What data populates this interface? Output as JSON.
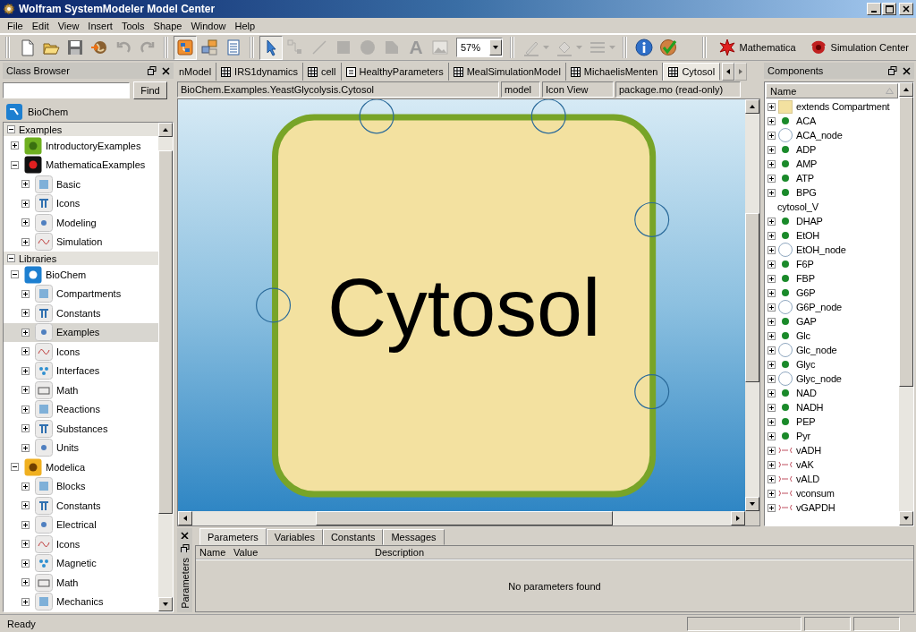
{
  "window": {
    "title": "Wolfram SystemModeler Model Center"
  },
  "menu": [
    "File",
    "Edit",
    "View",
    "Insert",
    "Tools",
    "Shape",
    "Window",
    "Help"
  ],
  "toolbar": {
    "groups": [
      [
        {
          "kind": "new",
          "disabled": false,
          "pressed": false
        },
        {
          "kind": "open",
          "disabled": false,
          "pressed": false
        },
        {
          "kind": "save",
          "disabled": false,
          "pressed": false
        },
        {
          "kind": "publish",
          "disabled": false,
          "pressed": false
        },
        {
          "kind": "undo",
          "disabled": true,
          "pressed": false
        },
        {
          "kind": "redo",
          "disabled": true,
          "pressed": false
        }
      ],
      [
        {
          "kind": "diagram",
          "disabled": false,
          "pressed": true
        },
        {
          "kind": "iconview",
          "disabled": false,
          "pressed": false
        },
        {
          "kind": "textview",
          "disabled": false,
          "pressed": false
        }
      ],
      [
        {
          "kind": "select",
          "disabled": false,
          "pressed": true
        },
        {
          "kind": "connect",
          "disabled": true,
          "pressed": false
        },
        {
          "kind": "line",
          "disabled": true,
          "pressed": false
        },
        {
          "kind": "rect",
          "disabled": true,
          "pressed": false
        },
        {
          "kind": "ellipse",
          "disabled": true,
          "pressed": false
        },
        {
          "kind": "polygon",
          "disabled": true,
          "pressed": false
        },
        {
          "kind": "text",
          "label": "A",
          "disabled": true,
          "pressed": false
        },
        {
          "kind": "bitmap",
          "disabled": true,
          "pressed": false
        },
        {
          "kind": "zoom",
          "value": "57%"
        }
      ],
      [
        {
          "kind": "linecolor",
          "disabled": true,
          "pressed": false
        },
        {
          "kind": "fillcolor",
          "disabled": true,
          "pressed": false
        },
        {
          "kind": "linestyle",
          "disabled": true,
          "pressed": false
        }
      ],
      [
        {
          "kind": "info",
          "disabled": false,
          "pressed": false
        },
        {
          "kind": "check",
          "disabled": false,
          "pressed": false
        }
      ],
      [
        {
          "kind": "mathematica",
          "label": "Mathematica",
          "disabled": false,
          "pressed": false
        },
        {
          "kind": "simulation",
          "label": "Simulation Center",
          "disabled": false,
          "pressed": false
        }
      ]
    ]
  },
  "class_browser": {
    "title": "Class Browser",
    "search_button": "Find",
    "library": "BioChem",
    "sections": [
      {
        "label": "Examples",
        "expanded": true,
        "items": [
          {
            "label": "IntroductoryExamples",
            "expanded": false,
            "selected": false
          },
          {
            "label": "MathematicaExamples",
            "expanded": true,
            "selected": false,
            "children": [
              {
                "label": "Basic",
                "expanded": false,
                "selected": false
              },
              {
                "label": "Icons",
                "expanded": false,
                "selected": false
              },
              {
                "label": "Modeling",
                "expanded": false,
                "selected": false
              },
              {
                "label": "Simulation",
                "expanded": false,
                "selected": false
              }
            ]
          }
        ]
      },
      {
        "label": "Libraries",
        "expanded": true,
        "items": [
          {
            "label": "BioChem",
            "expanded": true,
            "selected": false,
            "children": [
              {
                "label": "Compartments",
                "expanded": false,
                "selected": false
              },
              {
                "label": "Constants",
                "expanded": false,
                "selected": false
              },
              {
                "label": "Examples",
                "expanded": false,
                "selected": true
              },
              {
                "label": "Icons",
                "expanded": false,
                "selected": false
              },
              {
                "label": "Interfaces",
                "expanded": false,
                "selected": false
              },
              {
                "label": "Math",
                "expanded": false,
                "selected": false
              },
              {
                "label": "Reactions",
                "expanded": false,
                "selected": false
              },
              {
                "label": "Substances",
                "expanded": false,
                "selected": false
              },
              {
                "label": "Units",
                "expanded": false,
                "selected": false
              }
            ]
          },
          {
            "label": "Modelica",
            "expanded": true,
            "selected": false,
            "children": [
              {
                "label": "Blocks",
                "expanded": false,
                "selected": false
              },
              {
                "label": "Constants",
                "expanded": false,
                "selected": false
              },
              {
                "label": "Electrical",
                "expanded": false,
                "selected": false
              },
              {
                "label": "Icons",
                "expanded": false,
                "selected": false
              },
              {
                "label": "Magnetic",
                "expanded": false,
                "selected": false
              },
              {
                "label": "Math",
                "expanded": false,
                "selected": false
              },
              {
                "label": "Mechanics",
                "expanded": false,
                "selected": false
              }
            ]
          }
        ]
      }
    ]
  },
  "editor": {
    "tabs": [
      {
        "label": "nModel",
        "selected": false
      },
      {
        "label": "IRS1dynamics",
        "kind": "model",
        "selected": false
      },
      {
        "label": "cell",
        "kind": "model",
        "selected": false
      },
      {
        "label": "HealthyParameters",
        "kind": "record",
        "selected": false
      },
      {
        "label": "MealSimulationModel",
        "kind": "model",
        "selected": false
      },
      {
        "label": "MichaelisMenten",
        "kind": "model",
        "selected": false
      },
      {
        "label": "Cytosol",
        "kind": "model",
        "selected": true
      }
    ],
    "path": "BioChem.Examples.YeastGlycolysis.Cytosol",
    "restriction": "model",
    "view": "Icon View",
    "file": "package.mo (read-only)",
    "diagram": {
      "label": "Cytosol"
    }
  },
  "components": {
    "title": "Components",
    "column": "Name",
    "items": [
      {
        "kind": "folder",
        "label": "extends Compartment"
      },
      {
        "kind": "substance",
        "label": "ACA"
      },
      {
        "kind": "node",
        "label": "ACA_node"
      },
      {
        "kind": "substance",
        "label": "ADP"
      },
      {
        "kind": "substance",
        "label": "AMP"
      },
      {
        "kind": "substance",
        "label": "ATP"
      },
      {
        "kind": "substance",
        "label": "BPG"
      },
      {
        "kind": "parameter",
        "label": "cytosol_V"
      },
      {
        "kind": "substance",
        "label": "DHAP"
      },
      {
        "kind": "substance",
        "label": "EtOH"
      },
      {
        "kind": "node",
        "label": "EtOH_node"
      },
      {
        "kind": "substance",
        "label": "F6P"
      },
      {
        "kind": "substance",
        "label": "FBP"
      },
      {
        "kind": "substance",
        "label": "G6P"
      },
      {
        "kind": "node",
        "label": "G6P_node"
      },
      {
        "kind": "substance",
        "label": "GAP"
      },
      {
        "kind": "substance",
        "label": "Glc"
      },
      {
        "kind": "node",
        "label": "Glc_node"
      },
      {
        "kind": "substance",
        "label": "Glyc"
      },
      {
        "kind": "node",
        "label": "Glyc_node"
      },
      {
        "kind": "substance",
        "label": "NAD"
      },
      {
        "kind": "substance",
        "label": "NADH"
      },
      {
        "kind": "substance",
        "label": "PEP"
      },
      {
        "kind": "substance",
        "label": "Pyr"
      },
      {
        "kind": "reaction",
        "label": "vADH"
      },
      {
        "kind": "reaction",
        "label": "vAK"
      },
      {
        "kind": "reaction",
        "label": "vALD"
      },
      {
        "kind": "reaction",
        "label": "vconsum"
      },
      {
        "kind": "reaction",
        "label": "vGAPDH"
      }
    ]
  },
  "parameters_panel": {
    "side_label": "Parameters",
    "tabs": [
      {
        "label": "Parameters",
        "selected": true
      },
      {
        "label": "Variables",
        "selected": false
      },
      {
        "label": "Constants",
        "selected": false
      },
      {
        "label": "Messages",
        "selected": false
      }
    ],
    "columns": [
      "Name",
      "Value",
      "Description"
    ],
    "empty_message": "No parameters found"
  },
  "status_bar": {
    "message": "Ready"
  }
}
